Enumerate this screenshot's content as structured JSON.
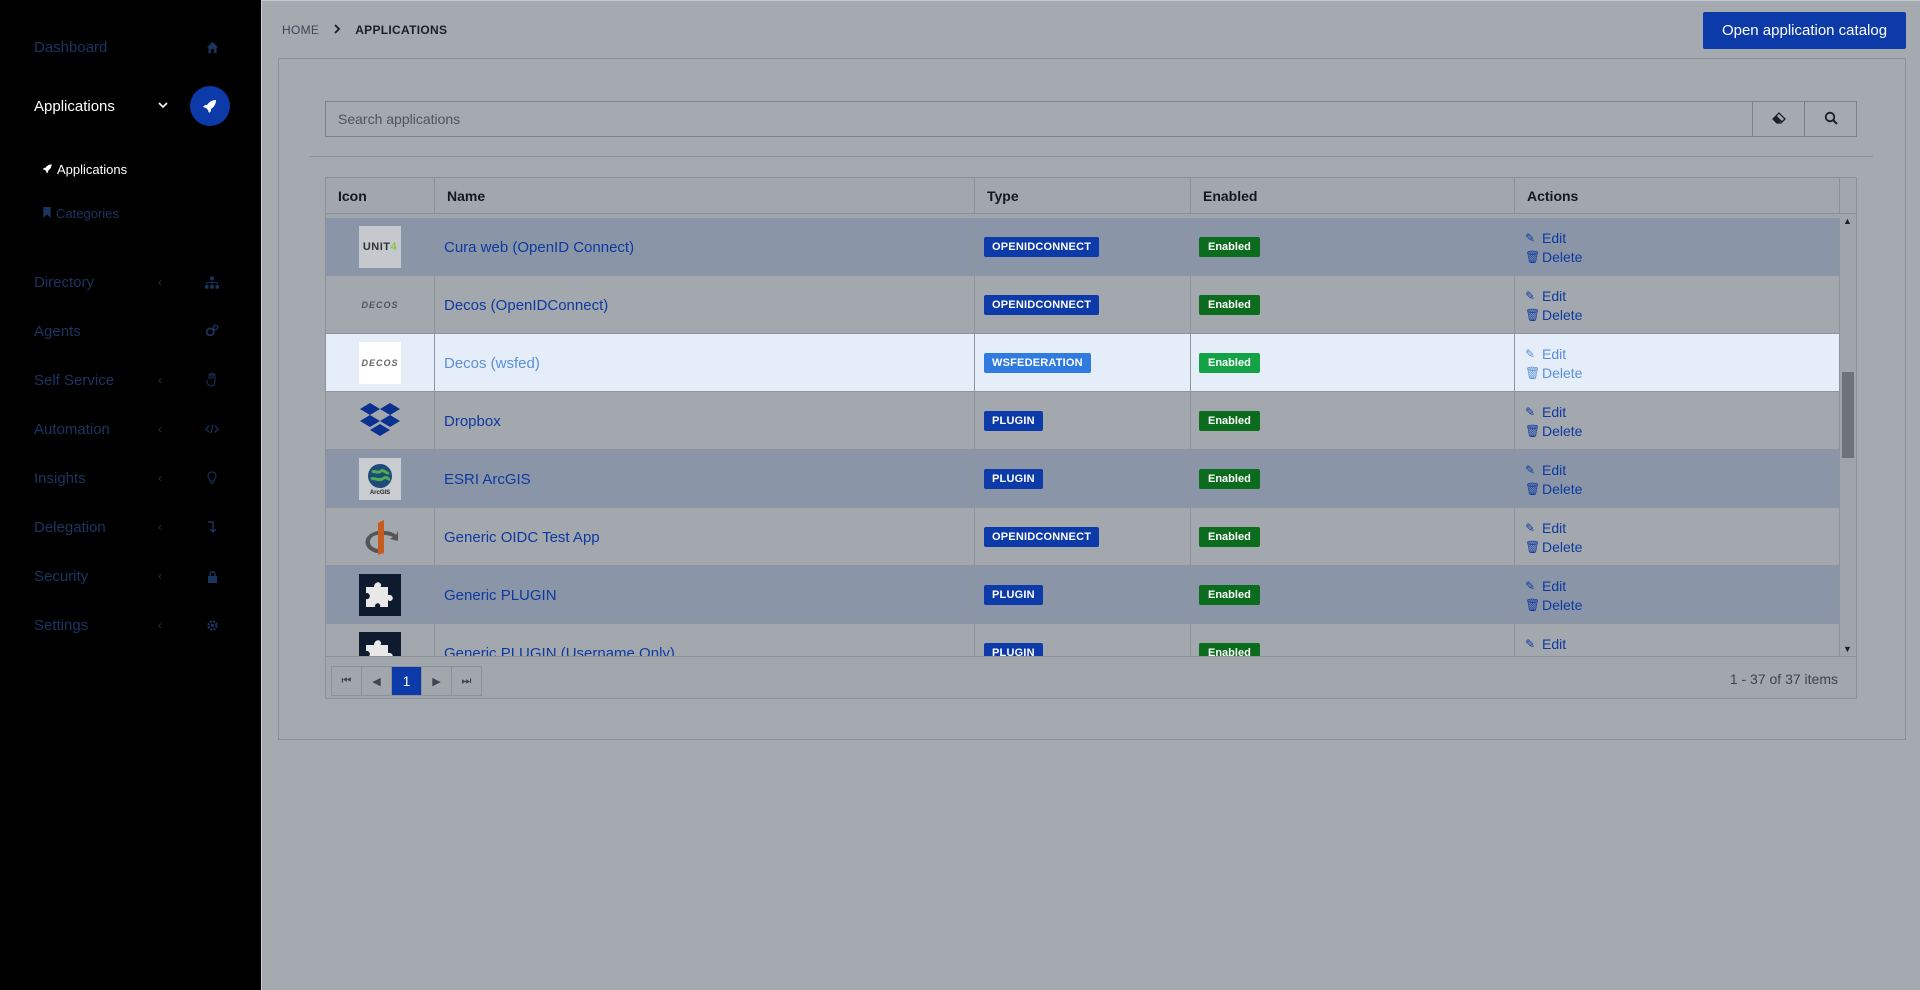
{
  "sidebar": {
    "items": [
      {
        "label": "Dashboard",
        "icon": "home-icon"
      },
      {
        "label": "Applications",
        "icon": "rocket-icon"
      },
      {
        "label": "Directory",
        "icon": "sitemap-icon"
      },
      {
        "label": "Agents",
        "icon": "cogs-icon"
      },
      {
        "label": "Self Service",
        "icon": "hand-icon"
      },
      {
        "label": "Automation",
        "icon": "code-icon"
      },
      {
        "label": "Insights",
        "icon": "lightbulb-icon"
      },
      {
        "label": "Delegation",
        "icon": "level-down-icon"
      },
      {
        "label": "Security",
        "icon": "lock-icon"
      },
      {
        "label": "Settings",
        "icon": "gear-icon"
      }
    ],
    "subitems": [
      {
        "label": "Applications"
      },
      {
        "label": "Categories"
      }
    ]
  },
  "breadcrumb": {
    "home": "HOME",
    "current": "APPLICATIONS"
  },
  "header": {
    "catalog_button": "Open application catalog"
  },
  "search": {
    "placeholder": "Search applications"
  },
  "table": {
    "columns": [
      "Icon",
      "Name",
      "Type",
      "Enabled",
      "Actions"
    ],
    "rows": [
      {
        "name": "Cura web (OpenID Connect)",
        "type": "OPENIDCONNECT",
        "enabled": "Enabled",
        "logo": "UNIT4"
      },
      {
        "name": "Decos (OpenIDConnect)",
        "type": "OPENIDCONNECT",
        "enabled": "Enabled",
        "logo": "DECOS"
      },
      {
        "name": "Decos (wsfed)",
        "type": "WSFEDERATION",
        "enabled": "Enabled",
        "logo": "DECOS"
      },
      {
        "name": "Dropbox",
        "type": "PLUGIN",
        "enabled": "Enabled",
        "logo": ""
      },
      {
        "name": "ESRI ArcGIS",
        "type": "PLUGIN",
        "enabled": "Enabled",
        "logo": "ArcGIS"
      },
      {
        "name": "Generic OIDC Test App",
        "type": "OPENIDCONNECT",
        "enabled": "Enabled",
        "logo": ""
      },
      {
        "name": "Generic PLUGIN",
        "type": "PLUGIN",
        "enabled": "Enabled",
        "logo": ""
      },
      {
        "name": "Generic PLUGIN (Username Only)",
        "type": "PLUGIN",
        "enabled": "Enabled",
        "logo": ""
      }
    ],
    "edit_label": "Edit",
    "delete_label": "Delete"
  },
  "pager": {
    "current_page": "1",
    "info": "1 - 37 of 37 items"
  },
  "colors": {
    "accent": "#0c3aa8",
    "enabled": "#0b6c1d",
    "sidebar_bg": "#000000"
  }
}
